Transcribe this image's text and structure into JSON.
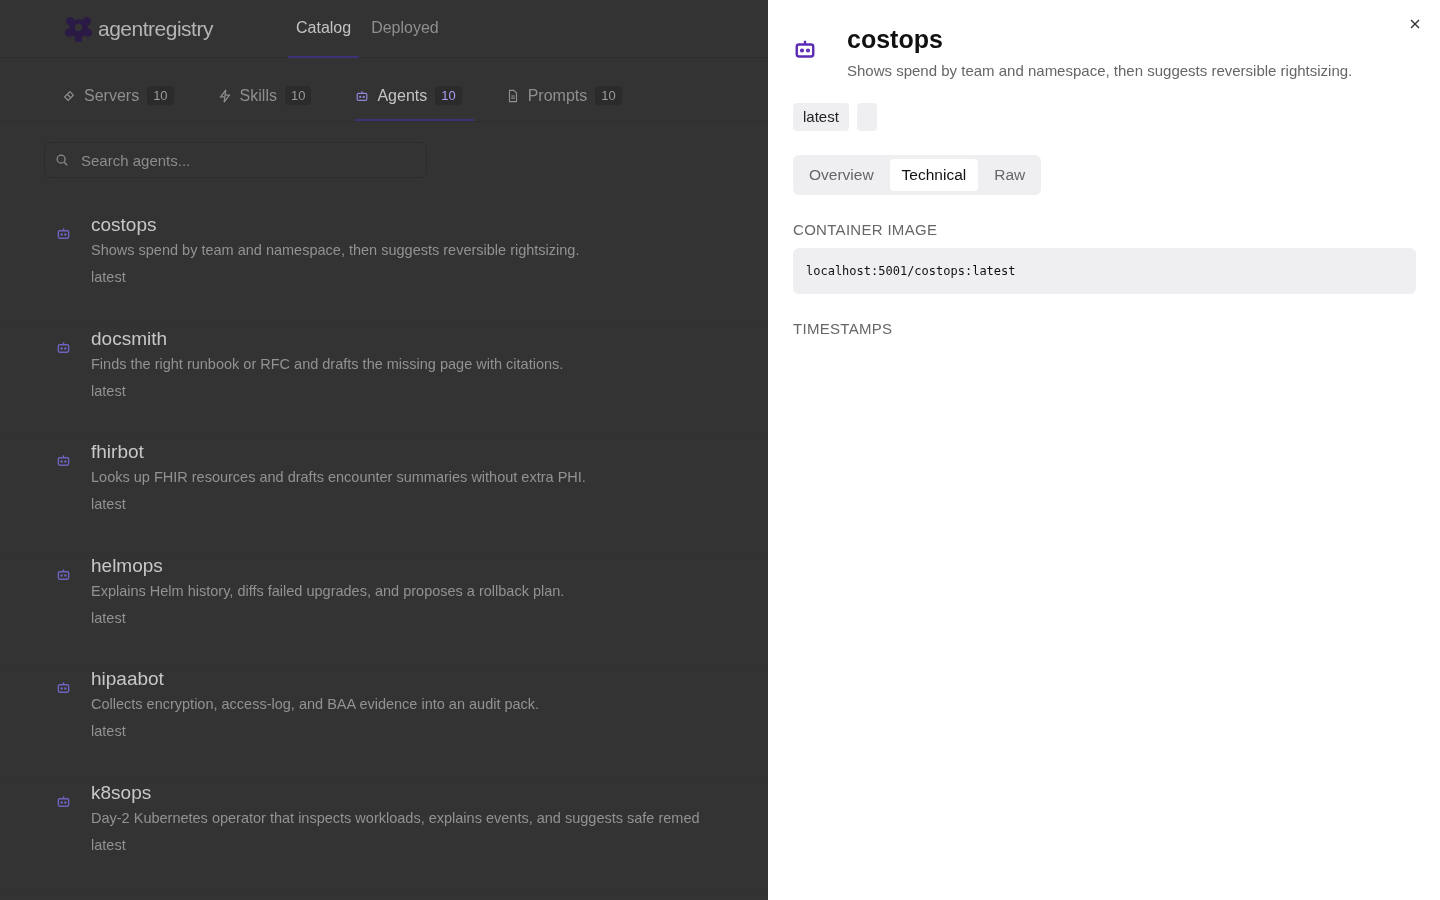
{
  "brand": {
    "name": "agentregistry"
  },
  "nav_tabs": [
    {
      "label": "Catalog",
      "selected": true
    },
    {
      "label": "Deployed",
      "selected": false
    }
  ],
  "sub_tabs": [
    {
      "kind": "server",
      "label": "Servers",
      "count": "10",
      "selected": false
    },
    {
      "kind": "skill",
      "label": "Skills",
      "count": "10",
      "selected": false
    },
    {
      "kind": "agent",
      "label": "Agents",
      "count": "10",
      "selected": true
    },
    {
      "kind": "prompt",
      "label": "Prompts",
      "count": "10",
      "selected": false
    }
  ],
  "search": {
    "placeholder": "Search agents..."
  },
  "agents": [
    {
      "name": "costops",
      "description": "Shows spend by team and namespace, then suggests reversible rightsizing.",
      "version": "latest"
    },
    {
      "name": "docsmith",
      "description": "Finds the right runbook or RFC and drafts the missing page with citations.",
      "version": "latest"
    },
    {
      "name": "fhirbot",
      "description": "Looks up FHIR resources and drafts encounter summaries without extra PHI.",
      "version": "latest"
    },
    {
      "name": "helmops",
      "description": "Explains Helm history, diffs failed upgrades, and proposes a rollback plan.",
      "version": "latest"
    },
    {
      "name": "hipaabot",
      "description": "Collects encryption, access-log, and BAA evidence into an audit pack.",
      "version": "latest"
    },
    {
      "name": "k8sops",
      "description": "Day-2 Kubernetes operator that inspects workloads, explains events, and suggests safe remed",
      "version": "latest"
    }
  ],
  "drawer": {
    "title": "costops",
    "description": "Shows spend by team and namespace, then suggests reversible rightsizing.",
    "badges": [
      "latest"
    ],
    "blank_badge": true,
    "tabs": [
      {
        "label": "Overview",
        "selected": false
      },
      {
        "label": "Technical",
        "selected": true
      },
      {
        "label": "Raw",
        "selected": false
      }
    ],
    "sections": [
      {
        "heading": "CONTAINER IMAGE",
        "value": "localhost:5001/costops:latest"
      },
      {
        "heading": "TIMESTAMPS"
      }
    ]
  }
}
